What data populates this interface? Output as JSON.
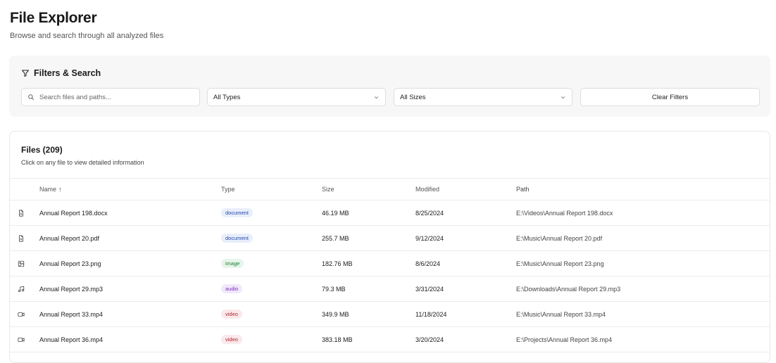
{
  "header": {
    "title": "File Explorer",
    "subtitle": "Browse and search through all analyzed files"
  },
  "filters": {
    "title": "Filters & Search",
    "search_placeholder": "Search files and paths...",
    "type_select": "All Types",
    "size_select": "All Sizes",
    "clear_label": "Clear Filters"
  },
  "files": {
    "title": "Files (209)",
    "subtitle": "Click on any file to view detailed information",
    "columns": {
      "name": "Name",
      "type": "Type",
      "size": "Size",
      "modified": "Modified",
      "path": "Path"
    },
    "sort_indicator": "↑",
    "rows": [
      {
        "icon": "document-icon",
        "name": "Annual Report 198.docx",
        "type": "document",
        "size": "46.19 MB",
        "modified": "8/25/2024",
        "path": "E:\\Videos\\Annual Report 198.docx"
      },
      {
        "icon": "document-icon",
        "name": "Annual Report 20.pdf",
        "type": "document",
        "size": "255.7 MB",
        "modified": "9/12/2024",
        "path": "E:\\Music\\Annual Report 20.pdf"
      },
      {
        "icon": "image-icon",
        "name": "Annual Report 23.png",
        "type": "image",
        "size": "182.76 MB",
        "modified": "8/6/2024",
        "path": "E:\\Music\\Annual Report 23.png"
      },
      {
        "icon": "music-icon",
        "name": "Annual Report 29.mp3",
        "type": "audio",
        "size": "79.3 MB",
        "modified": "3/31/2024",
        "path": "E:\\Downloads\\Annual Report 29.mp3"
      },
      {
        "icon": "video-icon",
        "name": "Annual Report 33.mp4",
        "type": "video",
        "size": "349.9 MB",
        "modified": "11/18/2024",
        "path": "E:\\Music\\Annual Report 33.mp4"
      },
      {
        "icon": "video-icon",
        "name": "Annual Report 36.mp4",
        "type": "video",
        "size": "383.18 MB",
        "modified": "3/20/2024",
        "path": "E:\\Projects\\Annual Report 36.mp4"
      }
    ]
  }
}
